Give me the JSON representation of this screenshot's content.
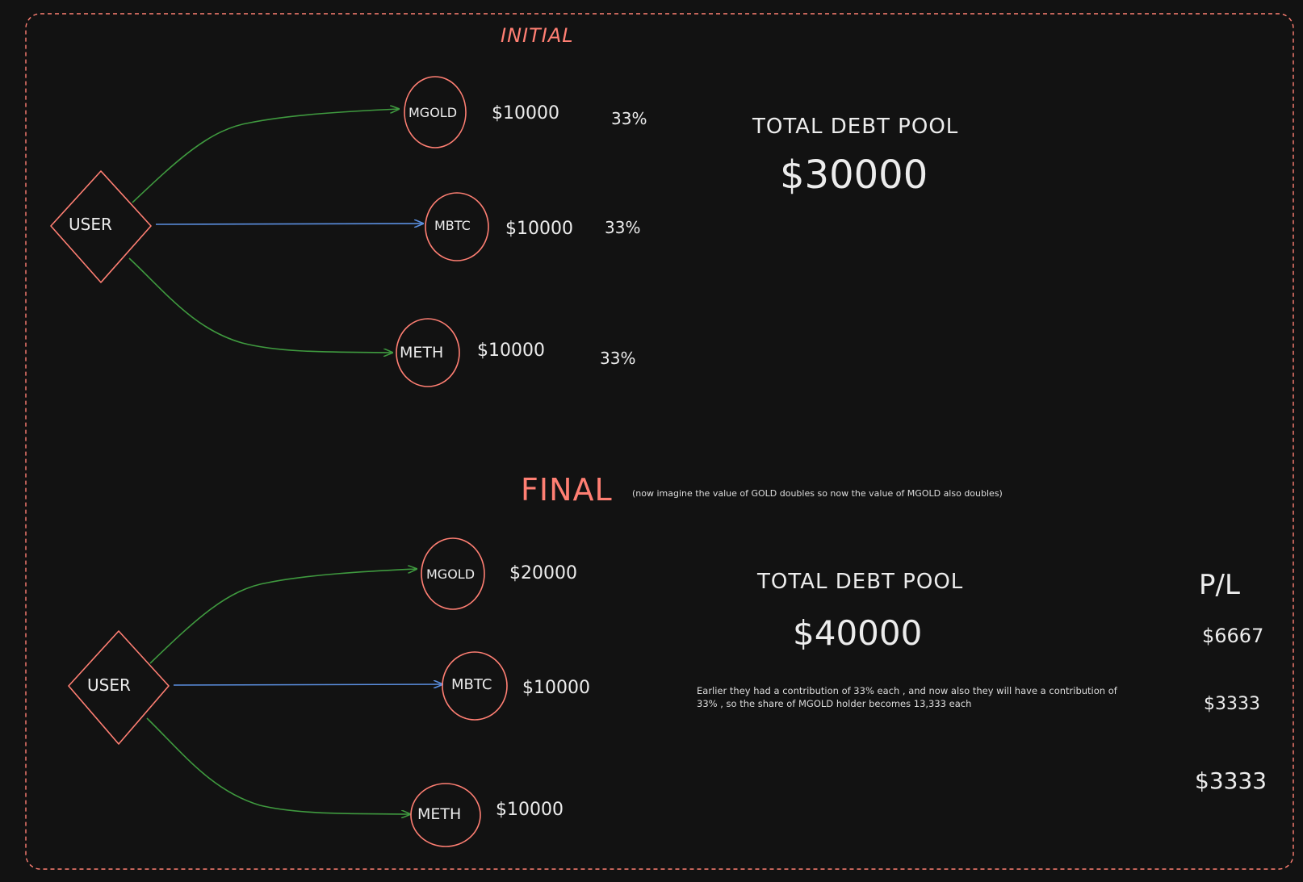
{
  "initial": {
    "section_title": "INITIAL",
    "user_label": "USER",
    "tokens": [
      {
        "name": "MGOLD",
        "value": "$10000",
        "pct": "33%"
      },
      {
        "name": "MBTC",
        "value": "$10000",
        "pct": "33%"
      },
      {
        "name": "METH",
        "value": "$10000",
        "pct": "33%"
      }
    ],
    "debt_pool_label": "TOTAL DEBT POOL",
    "debt_pool_value": "$30000"
  },
  "final": {
    "section_title": "FINAL",
    "note": "(now imagine the value of GOLD doubles so now the value of MGOLD also doubles)",
    "user_label": "USER",
    "tokens": [
      {
        "name": "MGOLD",
        "value": "$20000"
      },
      {
        "name": "MBTC",
        "value": "$10000"
      },
      {
        "name": "METH",
        "value": "$10000"
      }
    ],
    "debt_pool_label": "TOTAL DEBT POOL",
    "debt_pool_value": "$40000",
    "explanation_line1": "Earlier they had a contribution of 33% each , and now also they will have a contribution of",
    "explanation_line2": "33% , so the share of MGOLD holder becomes 13,333 each",
    "pl_label": "P/L",
    "pl_values": [
      "$6667",
      "$3333",
      "$3333"
    ]
  },
  "colors": {
    "background": "#121212",
    "node_stroke": "#ff7f73",
    "green_arrow": "#3f9a3f",
    "blue_arrow": "#5b8fe0",
    "frame": "#ff7f73",
    "text": "#e6e6e6"
  }
}
